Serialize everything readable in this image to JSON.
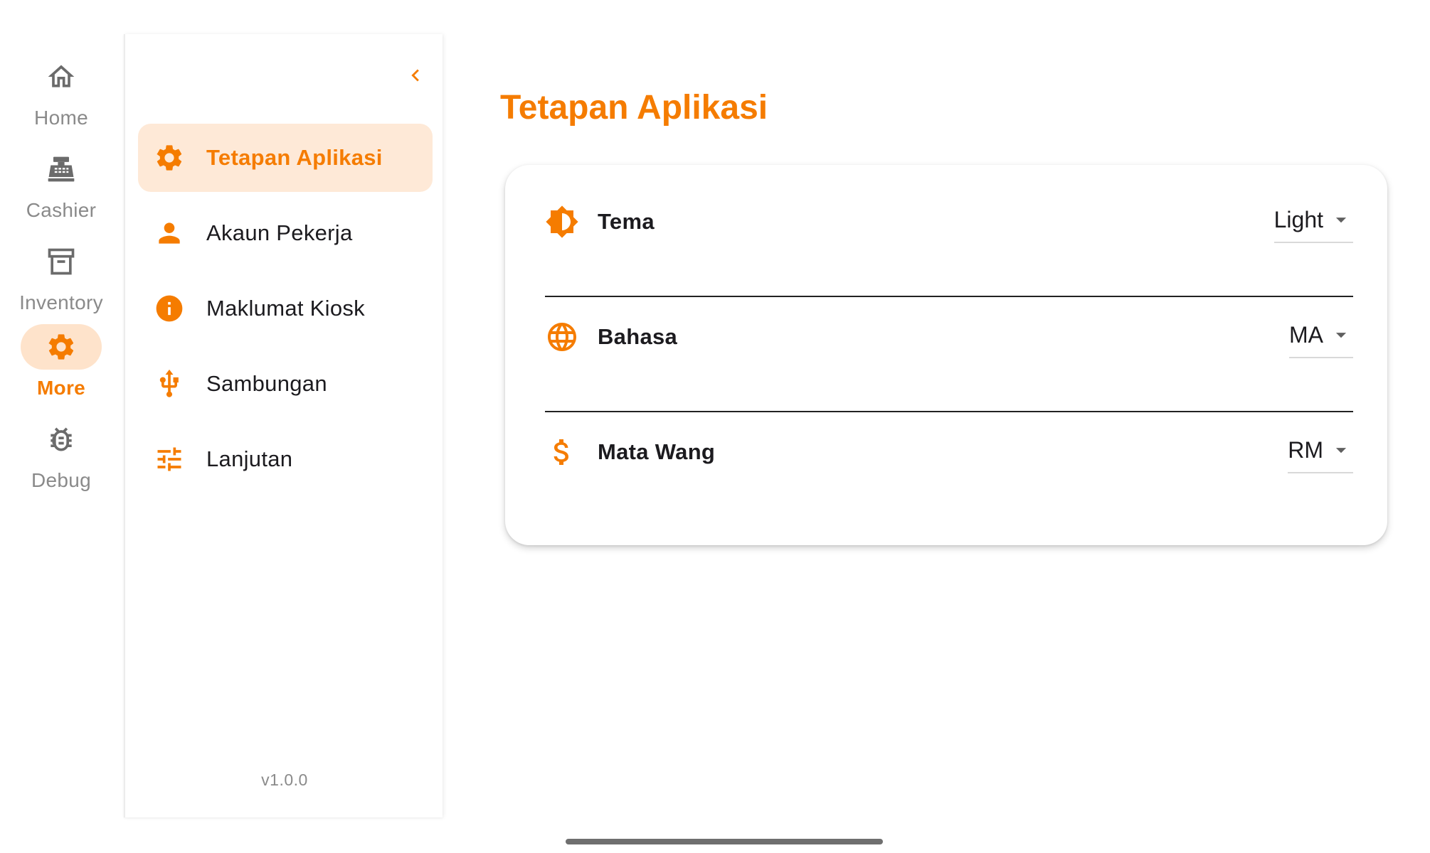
{
  "rail": {
    "items": [
      {
        "label": "Home",
        "icon": "home-icon",
        "active": false
      },
      {
        "label": "Cashier",
        "icon": "cash-register-icon",
        "active": false
      },
      {
        "label": "Inventory",
        "icon": "archive-box-icon",
        "active": false
      },
      {
        "label": "More",
        "icon": "gear-icon",
        "active": true
      },
      {
        "label": "Debug",
        "icon": "bug-icon",
        "active": false
      }
    ]
  },
  "subnav": {
    "collapse_icon": "chevron-left-icon",
    "items": [
      {
        "label": "Tetapan Aplikasi",
        "icon": "gear-icon",
        "active": true
      },
      {
        "label": "Akaun Pekerja",
        "icon": "person-icon",
        "active": false
      },
      {
        "label": "Maklumat Kiosk",
        "icon": "info-icon",
        "active": false
      },
      {
        "label": "Sambungan",
        "icon": "usb-icon",
        "active": false
      },
      {
        "label": "Lanjutan",
        "icon": "tune-sliders-icon",
        "active": false
      }
    ],
    "version": "v1.0.0"
  },
  "main": {
    "title": "Tetapan Aplikasi",
    "settings": [
      {
        "label": "Tema",
        "icon": "brightness-icon",
        "value": "Light"
      },
      {
        "label": "Bahasa",
        "icon": "globe-icon",
        "value": "MA"
      },
      {
        "label": "Mata Wang",
        "icon": "dollar-icon",
        "value": "RM"
      }
    ]
  },
  "colors": {
    "accent": "#f57c00",
    "accent_light": "#fee3cb",
    "muted_text": "#8a8a8a",
    "rail_icon": "#6b6b6b"
  }
}
